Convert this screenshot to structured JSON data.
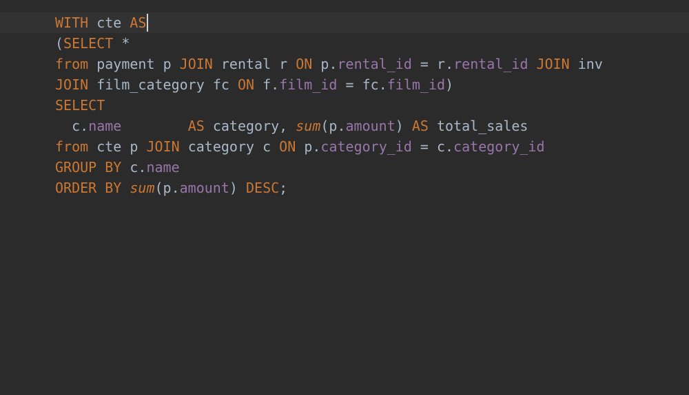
{
  "code": {
    "l1": {
      "WITH": "WITH",
      "sp1": " ",
      "cte": "cte",
      "sp2": " ",
      "AS": "AS"
    },
    "l2": {
      "lp": "(",
      "SELECT": "SELECT",
      "sp": " ",
      "star": "*"
    },
    "l3": {
      "from": "from",
      "sp1": " ",
      "payment": "payment",
      "sp2": " ",
      "p": "p",
      "sp3": " ",
      "JOIN1": "JOIN",
      "sp4": " ",
      "rental": "rental",
      "sp5": " ",
      "r": "r",
      "sp6": " ",
      "ON1": "ON",
      "sp7": " ",
      "p2": "p",
      "dot1": ".",
      "rental_id1": "rental_id",
      "sp8": " ",
      "eq1": "=",
      "sp9": " ",
      "r2": "r",
      "dot2": ".",
      "rental_id2": "rental_id",
      "sp10": " ",
      "JOIN2": "JOIN",
      "sp11": " ",
      "inv": "inv"
    },
    "l4": {
      "JOIN": "JOIN",
      "sp1": " ",
      "film_category": "film_category",
      "sp2": " ",
      "fc": "fc",
      "sp3": " ",
      "ON": "ON",
      "sp4": " ",
      "f": "f",
      "dot1": ".",
      "film_id1": "film_id",
      "sp5": " ",
      "eq": "=",
      "sp6": " ",
      "fc2": "fc",
      "dot2": ".",
      "film_id2": "film_id",
      "rp": ")"
    },
    "l5": {
      "SELECT": "SELECT"
    },
    "l6": {
      "indent": "  ",
      "c": "c",
      "dot1": ".",
      "name": "name",
      "pad": "        ",
      "AS1": "AS",
      "sp1": " ",
      "category": "category",
      "comma": ",",
      "sp2": " ",
      "sum": "sum",
      "lp": "(",
      "p": "p",
      "dot2": ".",
      "amount": "amount",
      "rp": ")",
      "sp3": " ",
      "AS2": "AS",
      "sp4": " ",
      "total_sales": "total_sales"
    },
    "l7": {
      "from": "from",
      "sp1": " ",
      "cte": "cte",
      "sp2": " ",
      "p": "p",
      "sp3": " ",
      "JOIN": "JOIN",
      "sp4": " ",
      "category": "category",
      "sp5": " ",
      "c": "c",
      "sp6": " ",
      "ON": "ON",
      "sp7": " ",
      "p2": "p",
      "dot1": ".",
      "category_id1": "category_id",
      "sp8": " ",
      "eq": "=",
      "sp9": " ",
      "c2": "c",
      "dot2": ".",
      "category_id2": "category_id"
    },
    "l8": {
      "GROUP": "GROUP BY",
      "sp1": " ",
      "c": "c",
      "dot": ".",
      "name": "name"
    },
    "l9": {
      "ORDER": "ORDER BY",
      "sp1": " ",
      "sum": "sum",
      "lp": "(",
      "p": "p",
      "dot": ".",
      "amount": "amount",
      "rp": ")",
      "sp2": " ",
      "DESC": "DESC",
      "semi": ";"
    }
  }
}
